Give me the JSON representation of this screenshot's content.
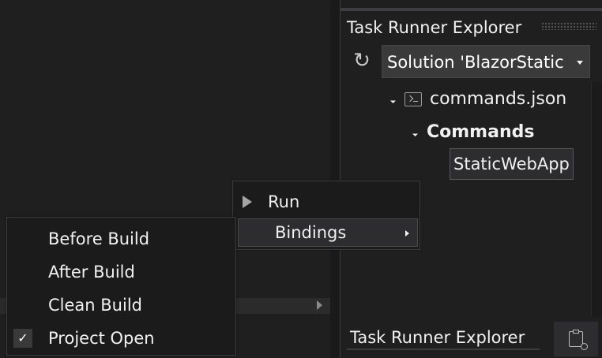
{
  "task_runner": {
    "title": "Task Runner Explorer",
    "solution_select_value": "Solution 'BlazorStatic",
    "tree": {
      "commands_file": "commands.json",
      "commands_group": "Commands",
      "task_item": "StaticWebApp"
    },
    "bottom_tab": "Task Runner Explorer"
  },
  "context_menu": {
    "run": "Run",
    "bindings": "Bindings"
  },
  "bindings_menu": {
    "items": [
      "Before Build",
      "After Build",
      "Clean Build",
      "Project Open"
    ],
    "checked_item": "Project Open",
    "check_mark": "✓"
  },
  "icons": {
    "refresh": "refresh-icon",
    "dropdown": "chevron-down-icon",
    "file": "json-file-icon",
    "run": "play-icon",
    "submenu": "chevron-right-icon",
    "clipboard": "clipboard-icon"
  },
  "colors": {
    "background": "#1f1f1f",
    "menu_background": "#1b1b1c",
    "highlight": "#2d2d30",
    "text": "#f1f1f1"
  }
}
